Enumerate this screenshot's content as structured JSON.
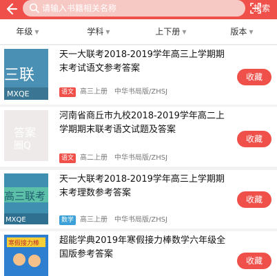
{
  "header": {
    "back_icon": "arrow-left-icon",
    "search_placeholder": "请输入书籍相关名称",
    "scan_icon": "scan-icon",
    "search_label": "搜索",
    "accent_color": "#f0504a"
  },
  "filters": [
    {
      "label": "年级"
    },
    {
      "label": "学科"
    },
    {
      "label": "上下册"
    },
    {
      "label": "版本"
    }
  ],
  "books": [
    {
      "title": "天一大联考2018-2019学年高三上学期期末考试语文参考答案",
      "subject": "语文",
      "subject_color": "#f0504a",
      "grade": "高三上册",
      "publisher": "中华书局版/ZHSJ",
      "action": "收藏",
      "cover_text": "三联",
      "cover_subtext": "MXQE",
      "cover_color": "#4a90b5"
    },
    {
      "title": "河南省商丘市九校2018-2019学年高二上学期期末联考语文试题及答案",
      "subject": "语文",
      "subject_color": "#f0504a",
      "grade": "高二上册",
      "publisher": "中华书局版/ZHSJ",
      "action": "收藏",
      "cover_text": "答案",
      "cover_subtext": "圈Q",
      "cover_color": "#efeaea"
    },
    {
      "title": "天一大联考2018-2019学年高三上学期期末考理数参考答案",
      "subject": "数学",
      "subject_color": "#3ba0d8",
      "grade": "高三上册",
      "publisher": "中华书局版/ZHSJ",
      "action": "收藏",
      "cover_text": "高三联考",
      "cover_subtext": "MXQE",
      "cover_color": "#3f8fb0"
    },
    {
      "title": "超能学典2019年寒假接力棒数学六年级全国版参考答案",
      "subject": "",
      "subject_color": "",
      "grade": "",
      "publisher": "",
      "action": "收藏",
      "cover_text": "寒假接力棒",
      "cover_subtext": "",
      "cover_color": "#2f7fd0"
    }
  ]
}
